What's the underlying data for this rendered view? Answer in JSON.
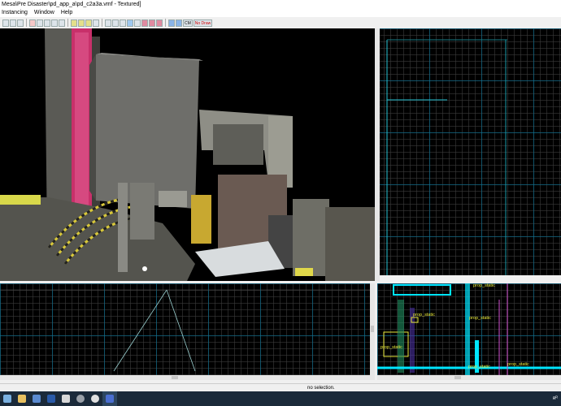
{
  "window": {
    "title": "Mesa\\Pre Disaster\\pd_app_a\\pd_c2a3a.vmf - Textured]"
  },
  "menu": {
    "items": [
      "Instancing",
      "Window",
      "Help"
    ]
  },
  "toolbar": {
    "cm_label": "CM",
    "nodraw_label": "No Draw",
    "buttons": [
      "file-icon",
      "folder-icon",
      "save-icon",
      "undo-icon",
      "redo-icon",
      "cut-icon",
      "copy-icon",
      "paste-icon",
      "grid-icon",
      "select-icon",
      "texture-icon",
      "entity-icon",
      "group-icon",
      "ungroup-icon",
      "hide-icon",
      "show-icon",
      "carve-icon",
      "clip-icon",
      "vertex-icon",
      "compile-icon",
      "run-icon"
    ]
  },
  "viewports": {
    "three_d": {
      "mode": "Textured"
    },
    "top": {
      "name": "top-2d"
    },
    "front": {
      "name": "front-2d"
    },
    "side": {
      "labels": [
        "prop_static",
        "prop_static",
        "prop_static",
        "prop_static",
        "prop_static",
        "prop_static"
      ]
    }
  },
  "statusbar": {
    "message": "no selection."
  },
  "taskbar": {
    "apps": [
      "windows-start",
      "file-explorer",
      "mail",
      "word",
      "explorer",
      "steam",
      "chrome",
      "hammer"
    ],
    "tray_text": "ʀᴿ"
  },
  "colors": {
    "grid_major": "#00789f",
    "grid_minor": "#3c3c3c",
    "selection_cyan": "#00e5ff",
    "label_yellow": "#e8e83a",
    "label_magenta": "#d050d0"
  }
}
